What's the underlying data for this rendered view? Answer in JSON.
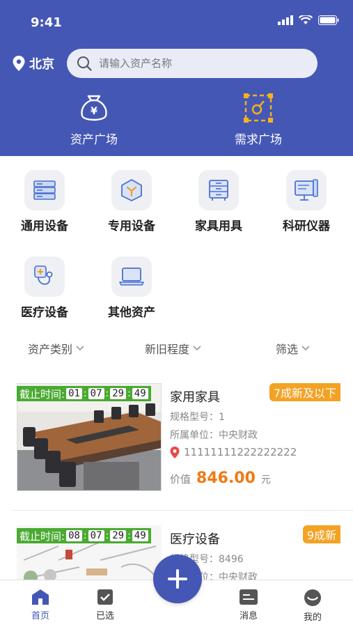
{
  "status_bar": {
    "time": "9:41"
  },
  "location": {
    "city": "北京"
  },
  "search": {
    "placeholder": "请输入资产名称"
  },
  "plazas": [
    {
      "label": "资产广场",
      "icon": "asset-bag-icon"
    },
    {
      "label": "需求广场",
      "icon": "demand-frame-icon"
    }
  ],
  "categories": [
    {
      "label": "通用设备",
      "icon": "server-icon"
    },
    {
      "label": "专用设备",
      "icon": "cube-icon"
    },
    {
      "label": "家具用具",
      "icon": "cabinet-icon"
    },
    {
      "label": "科研仪器",
      "icon": "monitor-icon"
    },
    {
      "label": "医疗设备",
      "icon": "stethoscope-icon"
    },
    {
      "label": "其他资产",
      "icon": "laptop-icon"
    }
  ],
  "filters": [
    {
      "label": "资产类别"
    },
    {
      "label": "新旧程度"
    },
    {
      "label": "筛选"
    }
  ],
  "listings": [
    {
      "deadline_label": "截止时间:",
      "countdown": [
        "01",
        "07",
        "29",
        "49"
      ],
      "title": "家用家具",
      "badge": "7成新及以下",
      "spec": "规格型号：1",
      "unit": "所属单位：中央财政",
      "address": "11111111222222222",
      "price_label": "价值",
      "price": "846.00",
      "price_unit": "元"
    },
    {
      "deadline_label": "截止时间:",
      "countdown": [
        "08",
        "07",
        "29",
        "49"
      ],
      "title": "医疗设备",
      "badge": "9成新",
      "spec": "规格型号：8496",
      "unit": "所属单位：中央财政"
    }
  ],
  "tabbar": [
    {
      "label": "首页",
      "icon": "home-icon",
      "active": true
    },
    {
      "label": "已选",
      "icon": "checked-box-icon"
    },
    {
      "label": "",
      "icon": "plus-icon"
    },
    {
      "label": "消息",
      "icon": "message-icon"
    },
    {
      "label": "我的",
      "icon": "user-icon"
    }
  ],
  "colors": {
    "primary": "#4557b5",
    "accent": "#f07a12",
    "badge": "#f4a224",
    "countdown_bg": "#4aaa32"
  }
}
